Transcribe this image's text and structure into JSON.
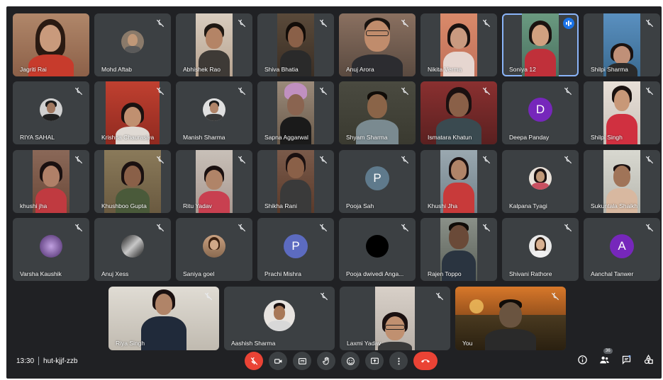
{
  "meeting": {
    "time": "13:30",
    "code": "hut-kjjf-zzb",
    "participant_count": "36"
  },
  "participants": [
    "Jagriti Rai",
    "Mohd Aftab",
    "Abhishek Rao",
    "Shiva Bhatia",
    "Anuj Arora",
    "Nikita Verma",
    "Soniya 12",
    "Shilpi Sharma",
    "RIYA SAHAL",
    "Krishna Chaurasiya",
    "Manish Sharma",
    "Sapna Aggarwal",
    "Shyam Sharma",
    "Ismatara Khatun",
    "Deepa Panday",
    "Shilpi Singh",
    "khushi jha",
    "Khushboo Gupta",
    "Ritu Yadav",
    "Shikha Rani",
    "Pooja Sah",
    "Khushi Jha",
    "Kalpana Tyagi",
    "Sukuntala Shaikh",
    "Varsha Kaushik",
    "Anuj Xess",
    "Saniya goel",
    "Prachi Mishra",
    "Pooja dwivedi Anga...",
    "Rajen Toppo",
    "Shivani Rathore",
    "Aanchal Tanwer",
    "Riya Singh",
    "Aashish Sharma",
    "Laxmi Yadav",
    "You"
  ],
  "letters": {
    "deepa": "D",
    "pooja": "P",
    "prachi": "P",
    "aanchal": "A"
  },
  "colors": {
    "background": "#202124",
    "tile": "#3c4043",
    "purple": "#7627bb",
    "slate": "#5f7a8c",
    "indigo": "#5c6bc0",
    "red": "#ea4335",
    "active": "#8ab4f8"
  },
  "icons": [
    "mic-off-icon",
    "camera-icon",
    "captions-icon",
    "raise-hand-icon",
    "emoji-icon",
    "present-icon",
    "more-icon",
    "hangup-icon",
    "info-icon",
    "people-icon",
    "chat-icon",
    "activities-icon"
  ]
}
